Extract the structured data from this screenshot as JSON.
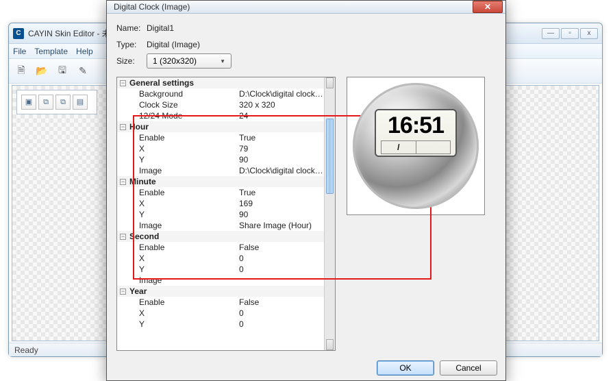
{
  "parent": {
    "title": "CAYIN Skin Editor - 未",
    "menu": [
      "File",
      "Template",
      "Help"
    ],
    "status": "Ready",
    "controls": {
      "min": "—",
      "max": "▫",
      "close": "x"
    }
  },
  "dialog": {
    "title": "Digital Clock (Image)",
    "name_label": "Name:",
    "name_value": "Digital1",
    "type_label": "Type:",
    "type_value": "Digital (Image)",
    "size_label": "Size:",
    "size_value": "1  (320x320)",
    "ok": "OK",
    "cancel": "Cancel"
  },
  "props": {
    "general": {
      "header": "General settings",
      "background_k": "Background",
      "background_v": "D:\\Clock\\digital clock\\M...",
      "clocksize_k": "Clock Size",
      "clocksize_v": "320 x 320",
      "mode_k": "12/24 Mode",
      "mode_v": "24"
    },
    "hour": {
      "header": "Hour",
      "enable_k": "Enable",
      "enable_v": "True",
      "x_k": "X",
      "x_v": "79",
      "y_k": "Y",
      "y_v": "90",
      "image_k": "Image",
      "image_v": "D:\\Clock\\digital clock\\M..."
    },
    "minute": {
      "header": "Minute",
      "enable_k": "Enable",
      "enable_v": "True",
      "x_k": "X",
      "x_v": "169",
      "y_k": "Y",
      "y_v": "90",
      "image_k": "Image",
      "image_v": "Share Image (Hour)"
    },
    "second": {
      "header": "Second",
      "enable_k": "Enable",
      "enable_v": "False",
      "x_k": "X",
      "x_v": "0",
      "y_k": "Y",
      "y_v": "0",
      "image_k": "Image",
      "image_v": ""
    },
    "year": {
      "header": "Year",
      "enable_k": "Enable",
      "enable_v": "False",
      "x_k": "X",
      "x_v": "0",
      "y_k": "Y",
      "y_v": "0"
    }
  },
  "preview": {
    "time": "16:51",
    "date_left": "/",
    "date_right": ""
  }
}
